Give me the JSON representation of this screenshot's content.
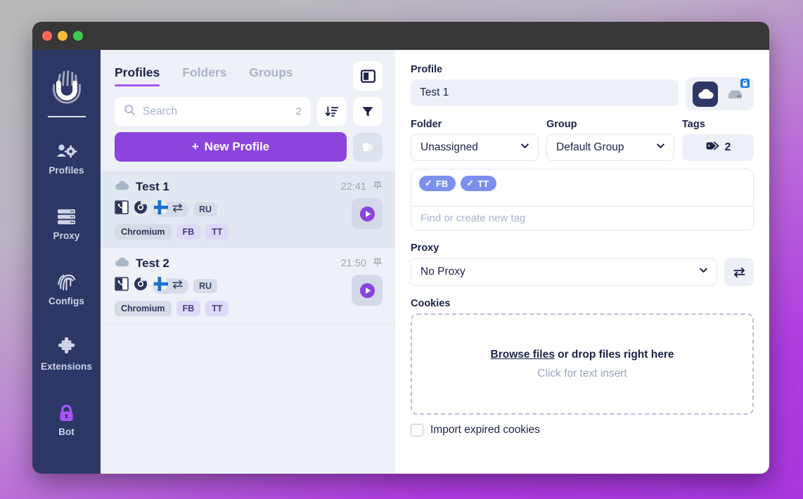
{
  "window": {
    "traffic_lights": [
      "close",
      "minimize",
      "maximize"
    ]
  },
  "sidebar": {
    "logo_name": "fingerprint-logo",
    "items": [
      {
        "label": "Profiles",
        "icon": "profiles-icon",
        "active": true
      },
      {
        "label": "Proxy",
        "icon": "server-icon",
        "active": false
      },
      {
        "label": "Configs",
        "icon": "fingerprint-icon",
        "active": false
      },
      {
        "label": "Extensions",
        "icon": "puzzle-icon",
        "active": false
      },
      {
        "label": "Bot",
        "icon": "lock-icon",
        "active": false
      }
    ]
  },
  "list_panel": {
    "tabs": [
      {
        "label": "Profiles",
        "active": true
      },
      {
        "label": "Folders",
        "active": false
      },
      {
        "label": "Groups",
        "active": false
      }
    ],
    "panel_toggle_icon": "panel-layout-icon",
    "search": {
      "placeholder": "Search",
      "value": "",
      "count": "2",
      "icon": "search-icon"
    },
    "sort_icon": "sort-descending-icon",
    "filter_icon": "filter-funnel-icon",
    "new_profile_label": "New Profile",
    "new_profile_plus": "+",
    "cards_toggle_icon": "cards-view-icon",
    "profiles": [
      {
        "name": "Test 1",
        "time": "22:41",
        "cloud_icon": "cloud-icon",
        "pin_icon": "pin-icon",
        "os_icon": "macos-window-icon",
        "browser_icon": "chrome-icon",
        "flag_icon": "finland-flag-icon",
        "proxy_icon": "transfer-arrows-icon",
        "language": "RU",
        "tags": [
          {
            "label": "Chromium",
            "style": "gray"
          },
          {
            "label": "FB",
            "style": "lilac"
          },
          {
            "label": "TT",
            "style": "lilac"
          }
        ],
        "play_icon": "play-icon",
        "selected": true
      },
      {
        "name": "Test 2",
        "time": "21:50",
        "cloud_icon": "cloud-icon",
        "pin_icon": "pin-icon",
        "os_icon": "macos-window-icon",
        "browser_icon": "chrome-icon",
        "flag_icon": "finland-flag-icon",
        "proxy_icon": "transfer-arrows-icon",
        "language": "RU",
        "tags": [
          {
            "label": "Chromium",
            "style": "gray"
          },
          {
            "label": "FB",
            "style": "lilac"
          },
          {
            "label": "TT",
            "style": "lilac"
          }
        ],
        "play_icon": "play-icon",
        "selected": false
      }
    ]
  },
  "detail": {
    "profile_label": "Profile",
    "profile_name": "Test 1",
    "storage": {
      "cloud_icon": "cloud-icon",
      "local_icon": "server-icon",
      "lock_icon": "lock-badge-icon",
      "selected": "cloud"
    },
    "folder_label": "Folder",
    "folder_value": "Unassigned",
    "group_label": "Group",
    "group_value": "Default Group",
    "tags_label": "Tags",
    "tags_count": "2",
    "tags_icon": "tag-icon",
    "tag_chips": [
      {
        "label": "FB",
        "check": "✓"
      },
      {
        "label": "TT",
        "check": "✓"
      }
    ],
    "tag_search_placeholder": "Find or create new tag",
    "tag_search_value": "",
    "proxy_label": "Proxy",
    "proxy_value": "No Proxy",
    "proxy_swap_icon": "transfer-arrows-icon",
    "cookies_label": "Cookies",
    "dropzone_browse": "Browse files",
    "dropzone_rest": " or drop files right here",
    "dropzone_hint": "Click for text insert",
    "import_checkbox_label": "Import expired cookies",
    "import_checked": false
  },
  "colors": {
    "sidebar_bg": "#2d3766",
    "accent_purple": "#8b45dc",
    "tab_underline": "#a855f7",
    "tag_chip": "#7b90ee",
    "selected_row": "#e1e8f2",
    "panel_bg": "#eef1f7",
    "text_dark": "#1b2347",
    "text_muted": "#a9b4c8"
  }
}
